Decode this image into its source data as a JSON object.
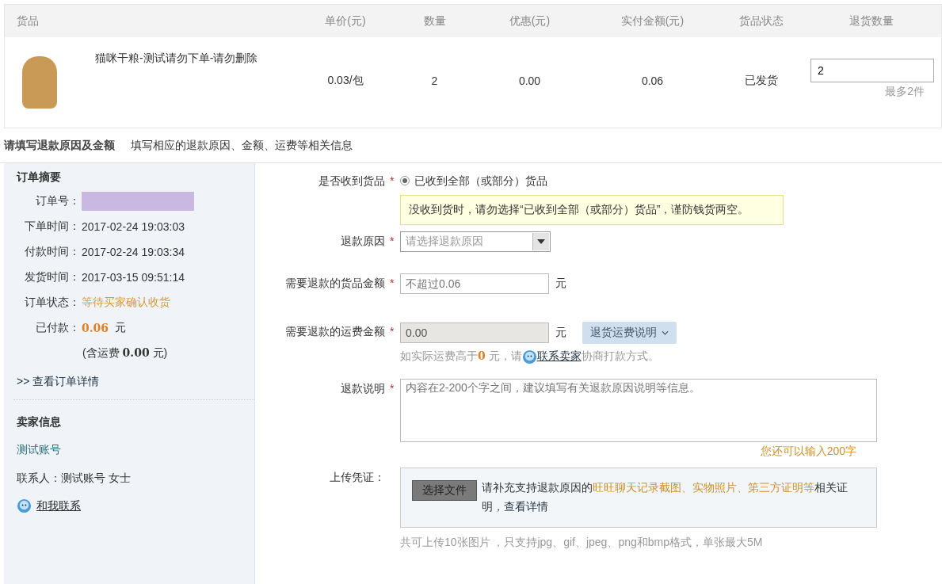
{
  "table": {
    "columns": [
      "货品",
      "单价(元)",
      "数量",
      "优惠(元)",
      "实付金额(元)",
      "货品状态",
      "退货数量"
    ],
    "rows": [
      {
        "name": "猫咪干粮-测试请勿下单-请勿删除",
        "price": "0.03/包",
        "qty": "2",
        "discount": "0.00",
        "paid": "0.06",
        "status": "已发货",
        "return_qty": "2",
        "return_hint": "最多2件"
      }
    ]
  },
  "section": {
    "title": "请填写退款原因及金额",
    "subtitle": "填写相应的退款原因、金额、运费等相关信息"
  },
  "summary": {
    "title": "订单摘要",
    "order_label": "订单号：",
    "rows": [
      {
        "label": "下单时间：",
        "value": "2017-02-24 19:03:03",
        "kind": "plain"
      },
      {
        "label": "付款时间：",
        "value": "2017-02-24 19:03:34",
        "kind": "plain"
      },
      {
        "label": "发货时间：",
        "value": "2017-03-15 09:51:14",
        "kind": "plain"
      },
      {
        "label": "订单状态：",
        "value": "等待买家确认收货",
        "kind": "status"
      }
    ],
    "paid_label": "已付款：",
    "paid_amount": "0.06",
    "paid_unit": "元",
    "freight_note": "(含运费 **0.00** 元)",
    "details_link": ">> 查看订单详情"
  },
  "seller": {
    "title": "卖家信息",
    "name": "测试账号",
    "contact": "联系人：测试账号 女士",
    "chat_link": "和我联系"
  },
  "form": [
    {
      "kind": "radio",
      "label": "是否收到货品",
      "mark": "*",
      "option": "已收到全部（或部分）货品",
      "selected": true,
      "notice": "没收到货时，请勿选择“已收到全部（或部分）货品”，谨防钱货两空。"
    },
    {
      "kind": "select",
      "label": "退款原因",
      "mark": "*",
      "placeholder": "请选择退款原因"
    },
    {
      "kind": "amount",
      "label": "需要退款的货品金额",
      "mark": "*",
      "placeholder": "不超过0.06",
      "unit": "元",
      "disabled": false
    },
    {
      "kind": "amount",
      "label": "需要退款的运费金额",
      "mark": "*",
      "value": "0.00",
      "unit": "元",
      "disabled": true,
      "button": "退货运费说明",
      "note": [
        {
          "kind": "text",
          "text": "如实际运费高于"
        },
        {
          "kind": "strong",
          "text": "0"
        },
        {
          "kind": "text",
          "text": " 元，请"
        },
        {
          "kind": "chat",
          "text": "联系卖家"
        },
        {
          "kind": "text",
          "text": "协商打款方式。"
        }
      ]
    },
    {
      "kind": "textarea",
      "label": "退款说明",
      "mark": "*",
      "placeholder": "内容在2-200个字之间，建议填写有关退款原因说明等信息。",
      "counter": "您还可以输入200字"
    },
    {
      "kind": "upload",
      "label": "上传凭证：",
      "button": "选择文件",
      "hint": [
        {
          "kind": "text",
          "text": "请补充支持退款原因的"
        },
        {
          "kind": "highlight",
          "text": "旺旺聊天记录截图、实物照片、第三方证明等"
        },
        {
          "kind": "text",
          "text": "相关证明，"
        },
        {
          "kind": "link",
          "text": "查看详情"
        }
      ],
      "note": "共可上传10张图片 ，只支持jpg、gif、jpeg、png和bmp格式，单张最大5M"
    }
  ]
}
